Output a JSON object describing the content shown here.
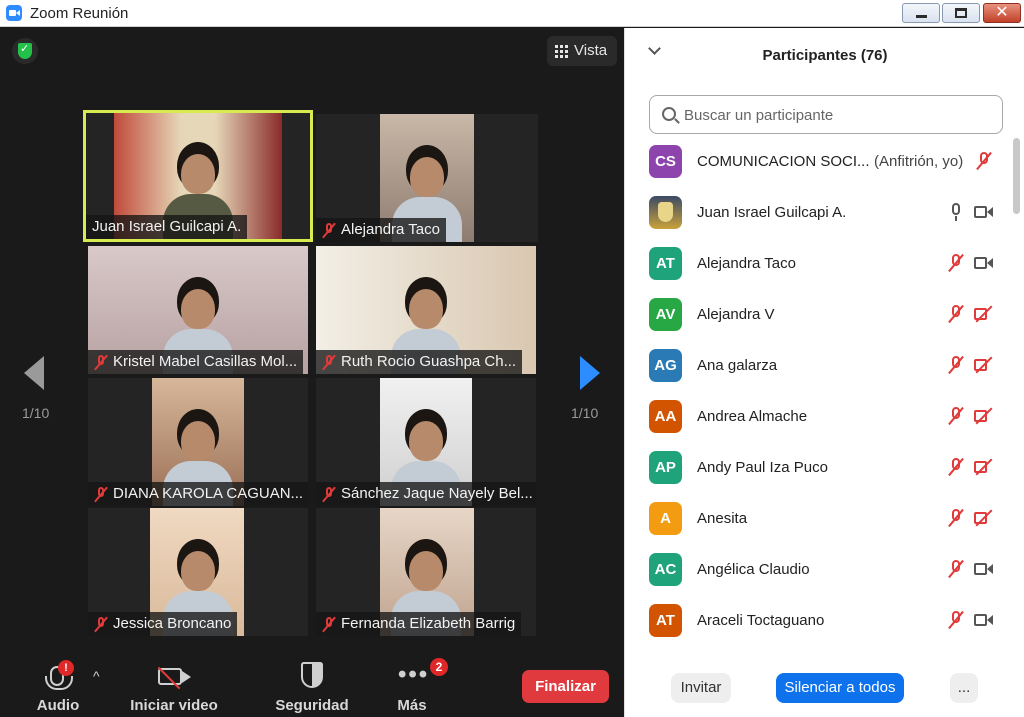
{
  "window": {
    "title": "Zoom Reunión",
    "close_glyph": "✕"
  },
  "video": {
    "view_label": "Vista",
    "page_left": "1/10",
    "page_right": "1/10",
    "tiles": [
      {
        "name": "Juan Israel Guilcapi A.",
        "muted": false,
        "active": true
      },
      {
        "name": "Alejandra Taco",
        "muted": true
      },
      {
        "name": "Kristel Mabel Casillas Mol...",
        "muted": true
      },
      {
        "name": "Ruth Rocio  Guashpa  Ch...",
        "muted": true
      },
      {
        "name": "DIANA KAROLA CAGUAN...",
        "muted": true
      },
      {
        "name": "Sánchez Jaque Nayely Bel...",
        "muted": true
      },
      {
        "name": "Jessica Broncano",
        "muted": true
      },
      {
        "name": "Fernanda Elizabeth Barrig",
        "muted": true
      }
    ]
  },
  "toolbar": {
    "audio_label": "Audio",
    "audio_badge": "!",
    "video_label": "Iniciar video",
    "security_label": "Seguridad",
    "more_label": "Más",
    "more_badge": "2",
    "end_label": "Finalizar"
  },
  "participants": {
    "title": "Participantes (76)",
    "search_placeholder": "Buscar un participante",
    "list": [
      {
        "initials": "CS",
        "color": "#8e44ad",
        "name": "COMUNICACION SOCI...",
        "role": "(Anfitrión, yo)",
        "mic": "off",
        "cam": "none"
      },
      {
        "initials": "",
        "color": "",
        "name": "Juan Israel Guilcapi A.",
        "role": "",
        "mic": "on",
        "cam": "on"
      },
      {
        "initials": "AT",
        "color": "#1fa37a",
        "name": "Alejandra Taco",
        "role": "",
        "mic": "off",
        "cam": "on"
      },
      {
        "initials": "AV",
        "color": "#27a845",
        "name": "Alejandra V",
        "role": "",
        "mic": "off",
        "cam": "off"
      },
      {
        "initials": "AG",
        "color": "#2a7ab5",
        "name": "Ana galarza",
        "role": "",
        "mic": "off",
        "cam": "off"
      },
      {
        "initials": "AA",
        "color": "#d35400",
        "name": "Andrea Almache",
        "role": "",
        "mic": "off",
        "cam": "off"
      },
      {
        "initials": "AP",
        "color": "#1fa37a",
        "name": "Andy Paul Iza Puco",
        "role": "",
        "mic": "off",
        "cam": "off"
      },
      {
        "initials": "A",
        "color": "#f39c12",
        "name": "Anesita",
        "role": "",
        "mic": "off",
        "cam": "off"
      },
      {
        "initials": "AC",
        "color": "#1fa37a",
        "name": "Angélica Claudio",
        "role": "",
        "mic": "off",
        "cam": "on"
      },
      {
        "initials": "AT",
        "color": "#d35400",
        "name": "Araceli Toctaguano",
        "role": "",
        "mic": "off",
        "cam": "on"
      }
    ],
    "invite_label": "Invitar",
    "mute_all_label": "Silenciar a todos",
    "more_label": "..."
  },
  "colors": {
    "accent": "#0e72ed",
    "end": "#e0393e",
    "muted": "#e03a3a",
    "active_border": "#d7ea4f"
  }
}
